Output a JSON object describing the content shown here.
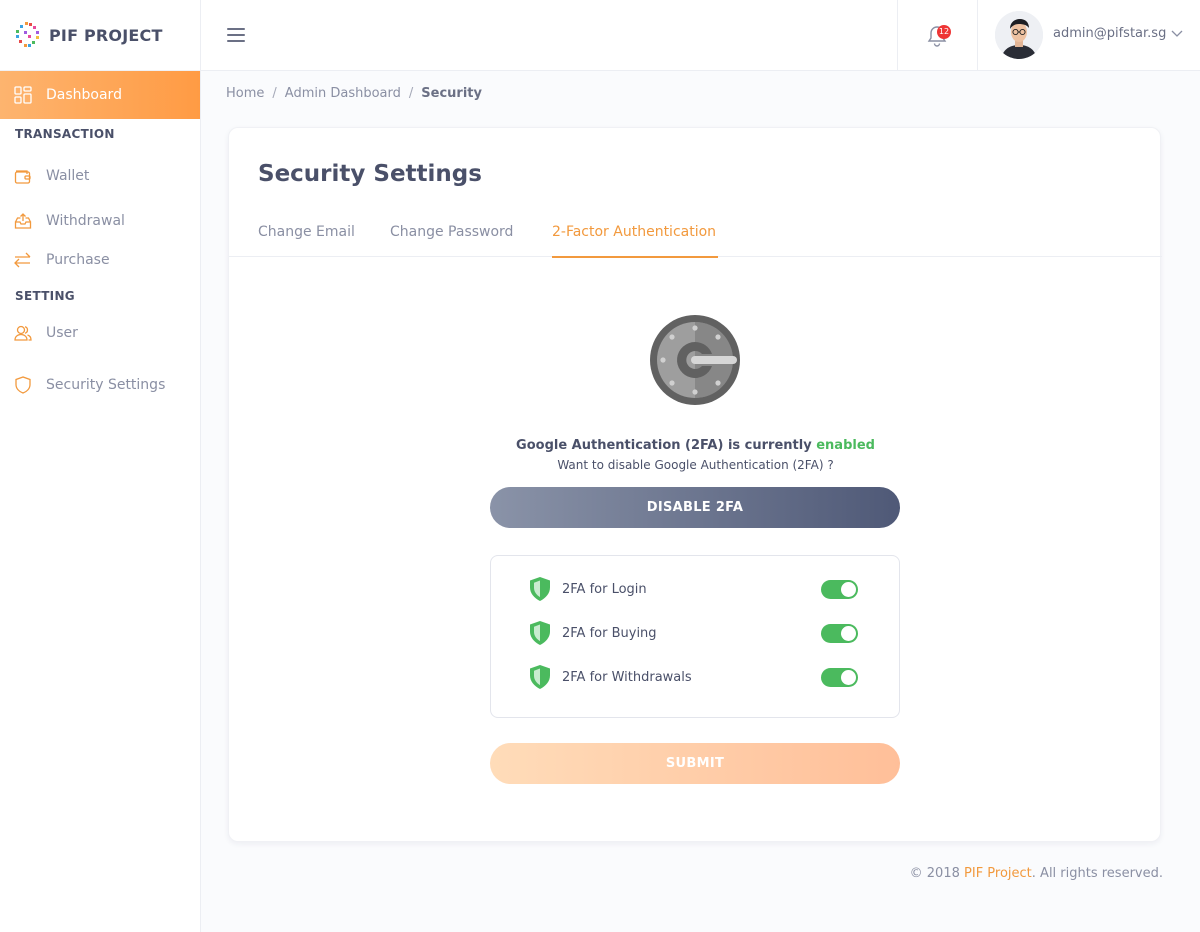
{
  "brand": {
    "name": "PIF PROJECT"
  },
  "sidebar": {
    "items": [
      {
        "label": "Dashboard",
        "icon": "dashboard-grid-icon"
      },
      {
        "section": "TRANSACTION"
      },
      {
        "label": "Wallet",
        "icon": "wallet-icon"
      },
      {
        "label": "Withdrawal",
        "icon": "withdrawal-tray-icon"
      },
      {
        "label": "Purchase",
        "icon": "exchange-arrows-icon"
      },
      {
        "section": "SETTING"
      },
      {
        "label": "User",
        "icon": "users-icon"
      },
      {
        "label": "Security Settings",
        "icon": "shield-icon"
      }
    ]
  },
  "header": {
    "notifications_count": "12",
    "user_email": "admin@pifstar.sg"
  },
  "breadcrumb": {
    "home": "Home",
    "parent": "Admin Dashboard",
    "current": "Security",
    "separator": "/"
  },
  "card": {
    "title": "Security Settings",
    "tabs": [
      {
        "label": "Change Email"
      },
      {
        "label": "Change Password"
      },
      {
        "label": "2-Factor Authentication"
      }
    ],
    "status_prefix": "Google Authentication (2FA) is currently",
    "status_value": "enabled",
    "sub_text": "Want to disable Google Authentication (2FA) ?",
    "disable_label": "DISABLE 2FA",
    "toggles": [
      {
        "label": "2FA for Login",
        "on": true
      },
      {
        "label": "2FA for Buying",
        "on": true
      },
      {
        "label": "2FA for Withdrawals",
        "on": true
      }
    ],
    "submit_label": "SUBMIT"
  },
  "footer": {
    "prefix": "© 2018",
    "brand": "PIF Project",
    "suffix": ". All rights reserved."
  },
  "colors": {
    "accent": "#f2993d",
    "success": "#4bba5e",
    "text": "#4a5069",
    "muted": "#8a8fa3"
  }
}
